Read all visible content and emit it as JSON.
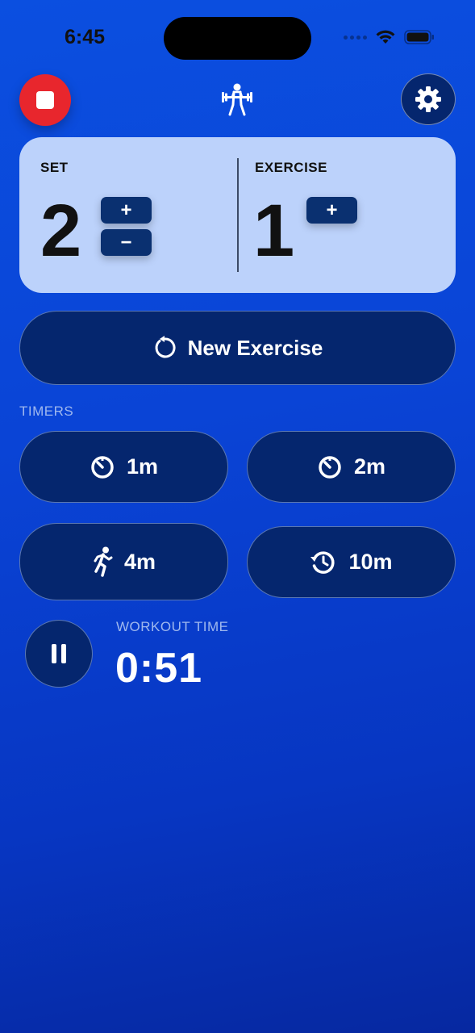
{
  "status_bar": {
    "time": "6:45"
  },
  "header": {
    "stop_icon": "stop-icon",
    "app_icon": "weightlifter-icon",
    "settings_icon": "gear-icon"
  },
  "counter": {
    "set_label": "SET",
    "set_value": "2",
    "exercise_label": "EXERCISE",
    "exercise_value": "1",
    "plus": "+",
    "minus": "−"
  },
  "new_exercise": {
    "label": "New Exercise",
    "icon": "restart-arrow-icon"
  },
  "timers": {
    "section_label": "TIMERS",
    "items": [
      {
        "label": "1m",
        "icon": "timer-icon"
      },
      {
        "label": "2m",
        "icon": "timer-icon"
      },
      {
        "label": "4m",
        "icon": "running-figure-icon"
      },
      {
        "label": "10m",
        "icon": "clock-arrow-icon"
      }
    ]
  },
  "workout": {
    "label": "WORKOUT TIME",
    "time": "0:51",
    "pause_icon": "pause-icon"
  },
  "colors": {
    "stop_red": "#e8262d",
    "card_bg": "#bcd2fb",
    "button_navy": "#05266e",
    "bg_blue": "#0b4fe0"
  }
}
